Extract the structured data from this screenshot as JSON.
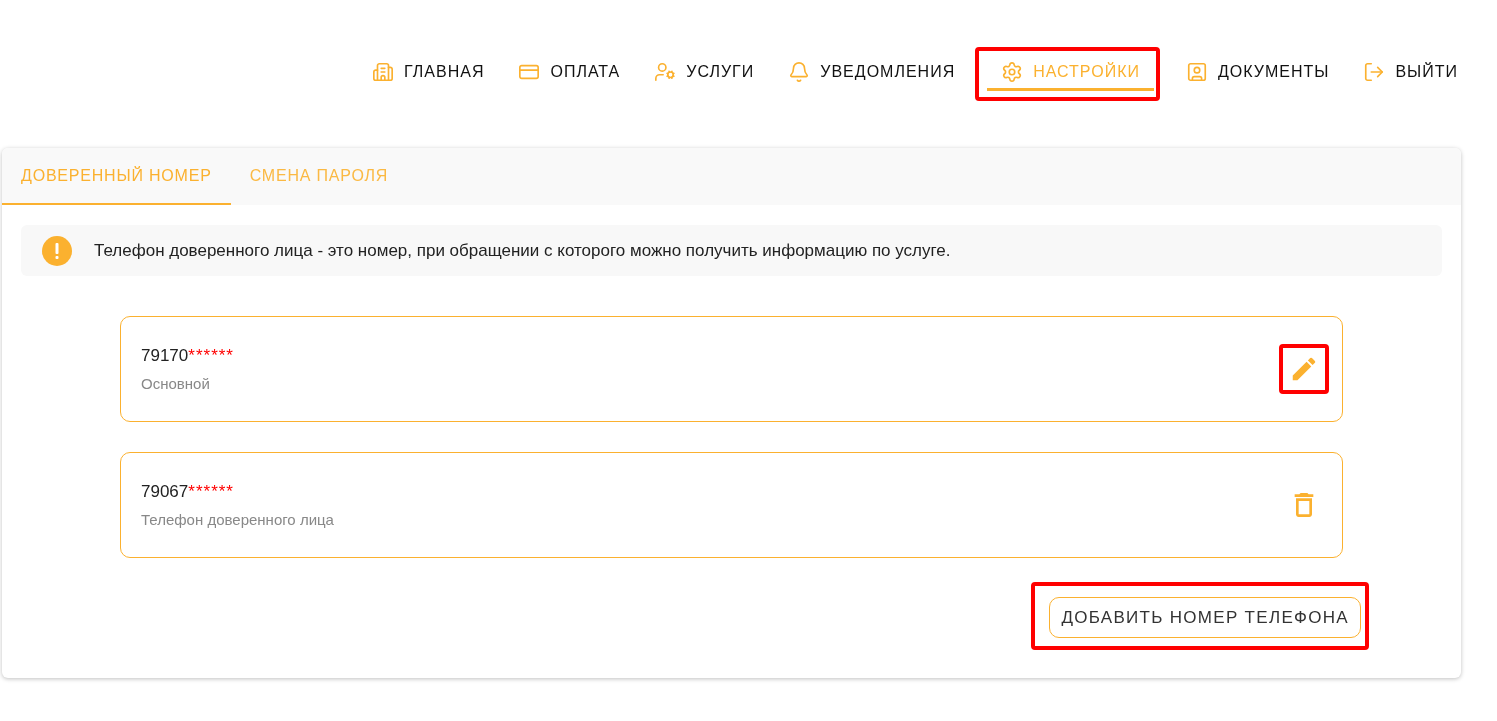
{
  "nav": [
    {
      "label": "ГЛАВНАЯ",
      "kind": "home",
      "selected": false,
      "highlighted": false
    },
    {
      "label": "ОПЛАТА",
      "kind": "card",
      "selected": false,
      "highlighted": false
    },
    {
      "label": "УСЛУГИ",
      "kind": "services",
      "selected": false,
      "highlighted": false
    },
    {
      "label": "УВЕДОМЛЕНИЯ",
      "kind": "bell",
      "selected": false,
      "highlighted": false
    },
    {
      "label": "НАСТРОЙКИ",
      "kind": "settings",
      "selected": true,
      "highlighted": true
    },
    {
      "label": "ДОКУМЕНТЫ",
      "kind": "documents",
      "selected": false,
      "highlighted": false
    },
    {
      "label": "ВЫЙТИ",
      "kind": "logout",
      "selected": false,
      "highlighted": false
    }
  ],
  "tabs": [
    {
      "label": "ДОВЕРЕННЫЙ НОМЕР",
      "selected": true
    },
    {
      "label": "СМЕНА ПАРОЛЯ",
      "selected": false
    }
  ],
  "alert": {
    "text": "Телефон доверенного лица - это номер, при обращении с которого можно получить информацию по услуге."
  },
  "phones": [
    {
      "number": "79170",
      "mask": "******",
      "label": "Основной",
      "kind": "edit",
      "highlighted": true
    },
    {
      "number": "79067",
      "mask": "******",
      "label": "Телефон доверенного лица",
      "kind": "delete",
      "highlighted": false
    }
  ],
  "add_button": {
    "label": "ДОБАВИТЬ НОМЕР ТЕЛЕФОНА",
    "highlighted": true
  }
}
